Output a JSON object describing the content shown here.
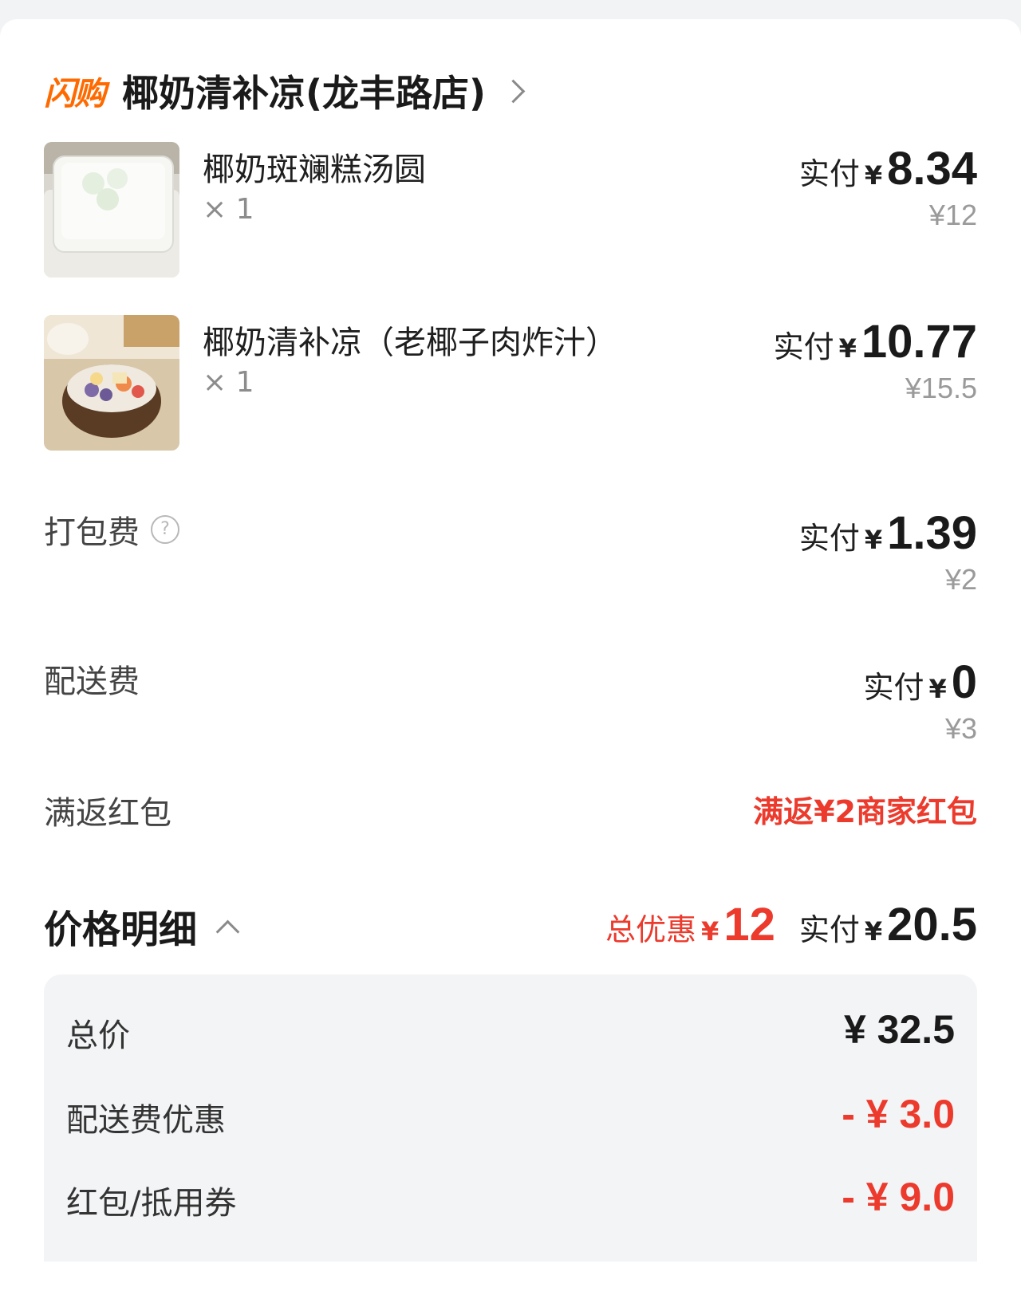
{
  "store": {
    "brand": "闪购",
    "name": "椰奶清补凉(龙丰路店)"
  },
  "items": [
    {
      "name": "椰奶斑斓糕汤圆",
      "qty": "× 1",
      "paid_label": "实付",
      "currency": "¥",
      "paid": "8.34",
      "original": "¥12"
    },
    {
      "name": "椰奶清补凉（老椰子肉炸汁）",
      "qty": "× 1",
      "paid_label": "实付",
      "currency": "¥",
      "paid": "10.77",
      "original": "¥15.5"
    }
  ],
  "fees": {
    "packing": {
      "label": "打包费",
      "help": "?",
      "paid_label": "实付",
      "currency": "¥",
      "paid": "1.39",
      "original": "¥2"
    },
    "delivery": {
      "label": "配送费",
      "paid_label": "实付",
      "currency": "¥",
      "paid": "0",
      "original": "¥3"
    },
    "rebate": {
      "label": "满返红包",
      "value": "满返¥2商家红包"
    }
  },
  "summary": {
    "title": "价格明细",
    "discount_label": "总优惠",
    "currency": "¥",
    "discount": "12",
    "paid_label": "实付",
    "paid": "20.5"
  },
  "details": [
    {
      "label": "总价",
      "value": "¥ 32.5"
    },
    {
      "label": "配送费优惠",
      "value": "- ¥ 3.0"
    },
    {
      "label": "红包/抵用券",
      "value": "- ¥ 9.0"
    }
  ],
  "colors": {
    "brand_orange": "#ff6a00",
    "discount_red": "#ec3a2d"
  }
}
